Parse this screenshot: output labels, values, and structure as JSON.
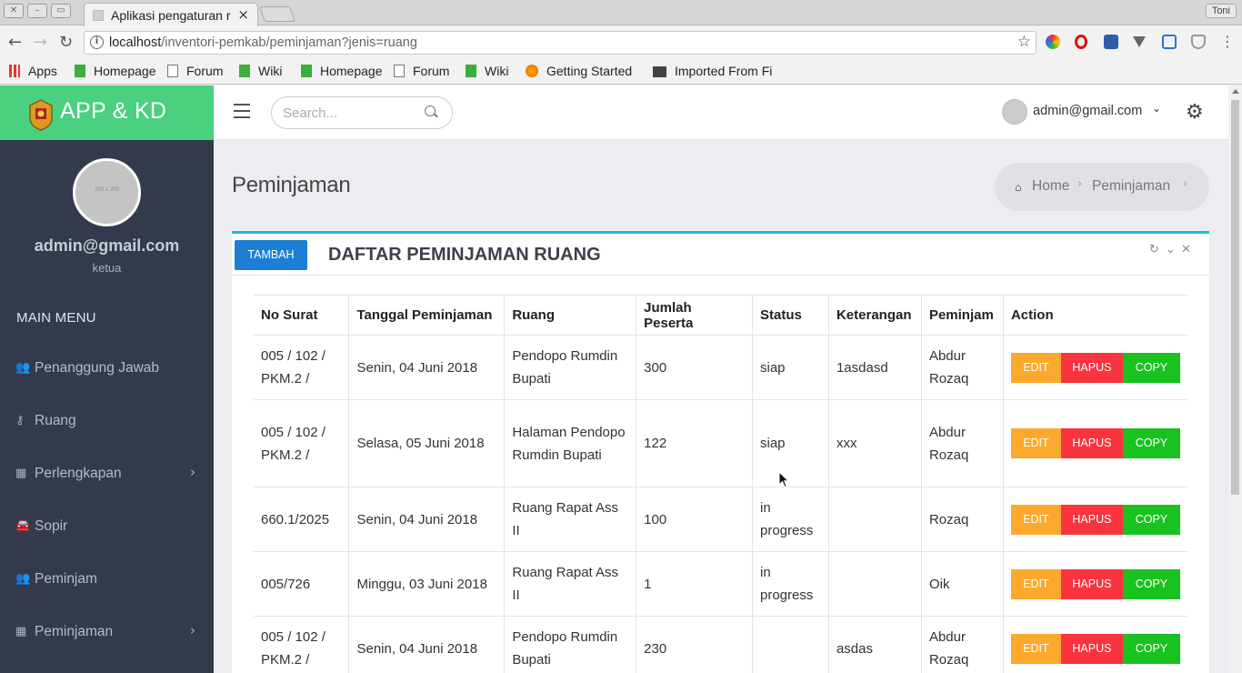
{
  "browser": {
    "tab_title": "Aplikasi pengaturan r",
    "profile": "Toni",
    "url_host": "localhost",
    "url_path": "/inventori-pemkab/peminjaman?jenis=ruang",
    "bookmarks": [
      "Apps",
      "Homepage",
      "Forum",
      "Wiki",
      "Homepage",
      "Forum",
      "Wiki",
      "Getting Started",
      "Imported From Fi"
    ]
  },
  "app": {
    "brand": "APP & KD",
    "avatar_placeholder": "200 x 200",
    "user_email": "admin@gmail.com",
    "user_role": "ketua",
    "menu_header": "MAIN MENU",
    "menu": [
      {
        "label": "Penanggung Jawab",
        "icon": "users-icon"
      },
      {
        "label": "Ruang",
        "icon": "key-icon"
      },
      {
        "label": "Perlengkapan",
        "icon": "grid-icon"
      },
      {
        "label": "Sopir",
        "icon": "car-icon"
      },
      {
        "label": "Peminjam",
        "icon": "users-icon"
      },
      {
        "label": "Peminjaman",
        "icon": "grid-icon"
      }
    ],
    "search_placeholder": "Search...",
    "top_user": "admin@gmail.com"
  },
  "page": {
    "title": "Peminjaman",
    "breadcrumb": [
      "Home",
      "Peminjaman"
    ],
    "add_button": "TAMBAH",
    "panel_title": "DAFTAR PEMINJAMAN RUANG",
    "columns": [
      "No Surat",
      "Tanggal Peminjaman",
      "Ruang",
      "Jumlah Peserta",
      "Status",
      "Keterangan",
      "Peminjam",
      "Action"
    ],
    "action_labels": {
      "edit": "EDIT",
      "hapus": "HAPUS",
      "copy": "COPY"
    },
    "rows": [
      {
        "no_surat": "005 / 102 / PKM.2 /",
        "tanggal": "Senin, 04 Juni 2018",
        "ruang": "Pendopo Rumdin Bupati",
        "jumlah": "300",
        "status": "siap",
        "keterangan": "1asdasd",
        "peminjam": "Abdur Rozaq"
      },
      {
        "no_surat": "005 / 102 / PKM.2 /",
        "tanggal": "Selasa, 05 Juni 2018",
        "ruang": "Halaman Pendopo Rumdin Bupati",
        "jumlah": "122",
        "status": "siap",
        "keterangan": "xxx",
        "peminjam": "Abdur Rozaq"
      },
      {
        "no_surat": "660.1/2025",
        "tanggal": "Senin, 04 Juni 2018",
        "ruang": "Ruang Rapat Ass II",
        "jumlah": "100",
        "status": "in progress",
        "keterangan": "",
        "peminjam": "Rozaq"
      },
      {
        "no_surat": "005/726",
        "tanggal": "Minggu, 03 Juni 2018",
        "ruang": "Ruang Rapat Ass II",
        "jumlah": "1",
        "status": "in progress",
        "keterangan": "",
        "peminjam": "Oik"
      },
      {
        "no_surat": "005 / 102 / PKM.2 /",
        "tanggal": "Senin, 04 Juni 2018",
        "ruang": "Pendopo Rumdin Bupati",
        "jumlah": "230",
        "status": "",
        "keterangan": "asdas",
        "peminjam": "Abdur Rozaq"
      }
    ]
  }
}
